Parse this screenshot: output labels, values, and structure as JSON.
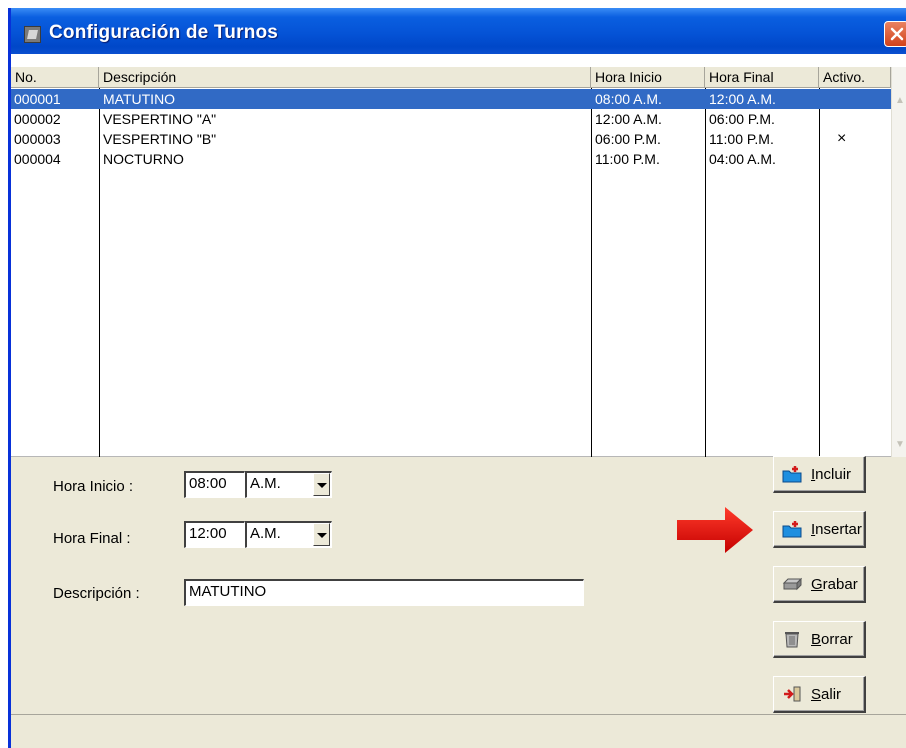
{
  "window": {
    "title": "Configuración de Turnos"
  },
  "table": {
    "headers": [
      "No.",
      "Descripción",
      "Hora Inicio",
      "Hora Final",
      "Activo."
    ],
    "rows": [
      {
        "no": "000001",
        "descripcion": "MATUTINO",
        "hora_inicio": "08:00 A.M.",
        "hora_final": "12:00 A.M.",
        "activo": ""
      },
      {
        "no": "000002",
        "descripcion": "VESPERTINO \"A\"",
        "hora_inicio": "12:00 A.M.",
        "hora_final": "06:00 P.M.",
        "activo": ""
      },
      {
        "no": "000003",
        "descripcion": "VESPERTINO \"B\"",
        "hora_inicio": "06:00 P.M.",
        "hora_final": "11:00 P.M.",
        "activo": "×"
      },
      {
        "no": "000004",
        "descripcion": "NOCTURNO",
        "hora_inicio": "11:00 P.M.",
        "hora_final": "04:00 A.M.",
        "activo": ""
      }
    ]
  },
  "form": {
    "hora_inicio_label": "Hora Inicio :",
    "hora_inicio_time": "08:00",
    "hora_inicio_ampm": "A.M.",
    "hora_final_label": "Hora Final :",
    "hora_final_time": "12:00",
    "hora_final_ampm": "A.M.",
    "descripcion_label": "Descripción :",
    "descripcion_value": "MATUTINO"
  },
  "buttons": {
    "incluir": {
      "mnemonic": "I",
      "rest": "ncluir"
    },
    "insertar": {
      "mnemonic": "I",
      "rest": "nsertar"
    },
    "grabar": {
      "mnemonic": "G",
      "rest": "rabar"
    },
    "borrar": {
      "mnemonic": "B",
      "rest": "orrar"
    },
    "salir": {
      "mnemonic": "S",
      "rest": "alir"
    }
  },
  "colors": {
    "selection": "#316ac5",
    "title_bar": "#0553d6",
    "annotation_arrow": "#e8090a"
  }
}
